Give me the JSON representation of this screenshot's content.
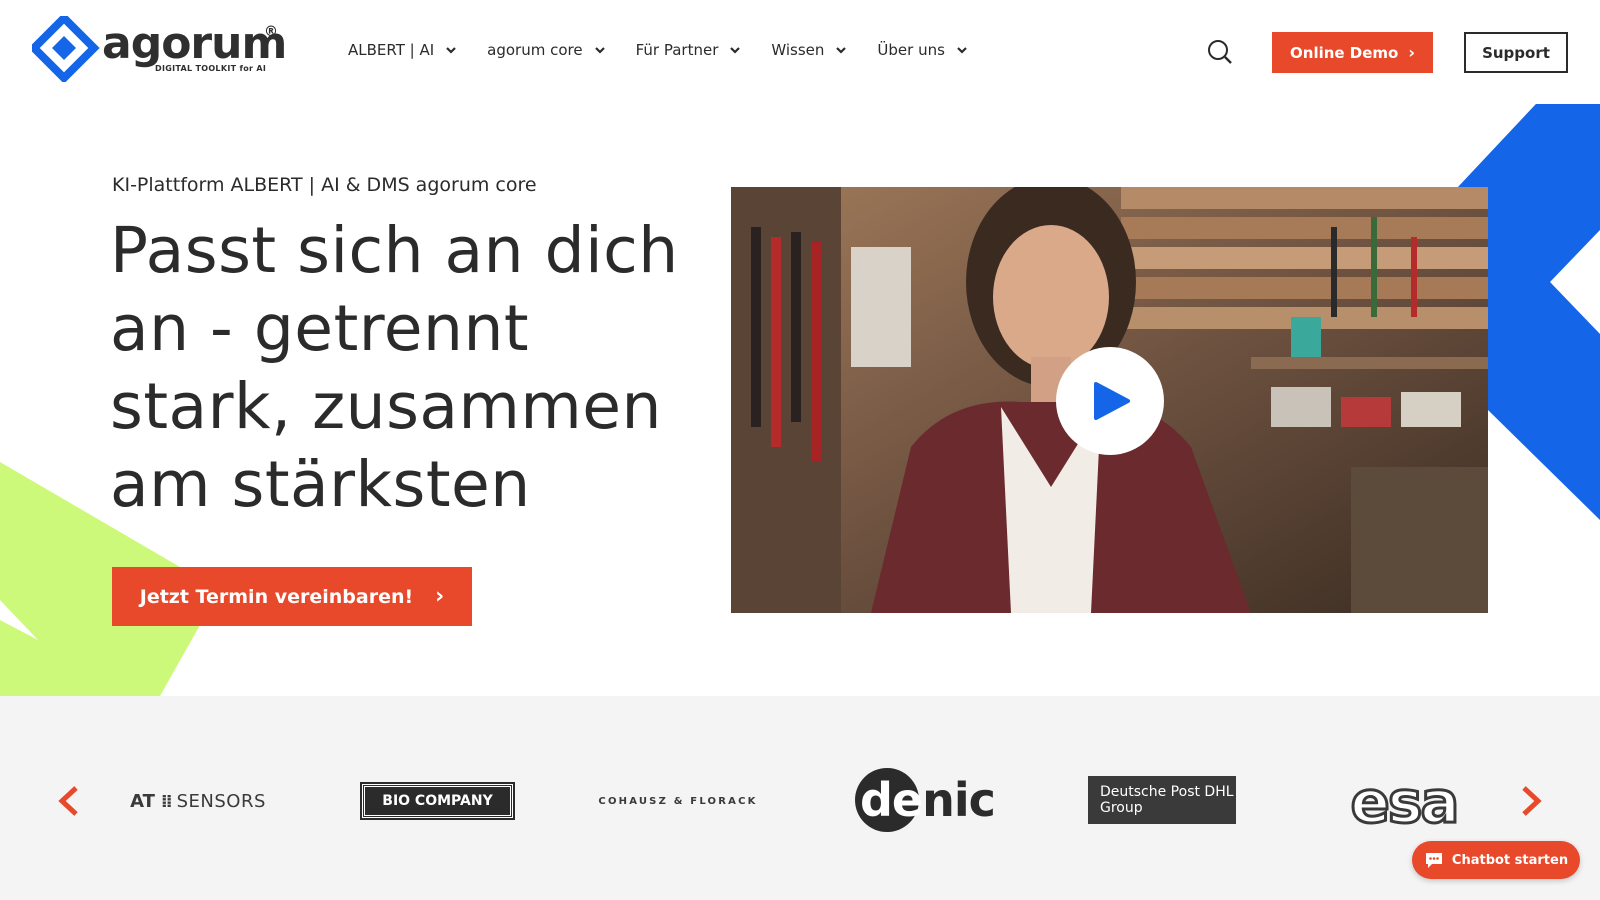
{
  "brand": {
    "name": "agorum",
    "registered": "®",
    "tagline": "DIGITAL TOOLKIT for AI",
    "blue": "#1565e8",
    "orange": "#e8492b",
    "lime": "#cdf97a"
  },
  "nav": {
    "items": [
      {
        "label": "ALBERT | AI"
      },
      {
        "label": "agorum core"
      },
      {
        "label": "Für Partner"
      },
      {
        "label": "Wissen"
      },
      {
        "label": "Über uns"
      }
    ],
    "search_icon": "search-icon",
    "demo_label": "Online Demo",
    "support_label": "Support"
  },
  "hero": {
    "eyebrow": "KI-Plattform ALBERT | AI & DMS agorum core",
    "headline": "Passt sich an dich an - getrennt stark, zusammen am stärksten",
    "cta_label": "Jetzt Termin vereinbaren!",
    "video_icon": "play-icon"
  },
  "partners": {
    "items": [
      {
        "at_bold": "AT",
        "at_rest": "SENSORS"
      },
      {
        "label": "BIO COMPANY"
      },
      {
        "label": "COHAUSZ & FLORACK"
      },
      {
        "label": "denic",
        "label_de": "de",
        "label_nic": "nic"
      },
      {
        "label": "Deutsche Post DHL Group"
      },
      {
        "label": "esa"
      }
    ]
  },
  "chatbot": {
    "label": "Chatbot starten"
  }
}
